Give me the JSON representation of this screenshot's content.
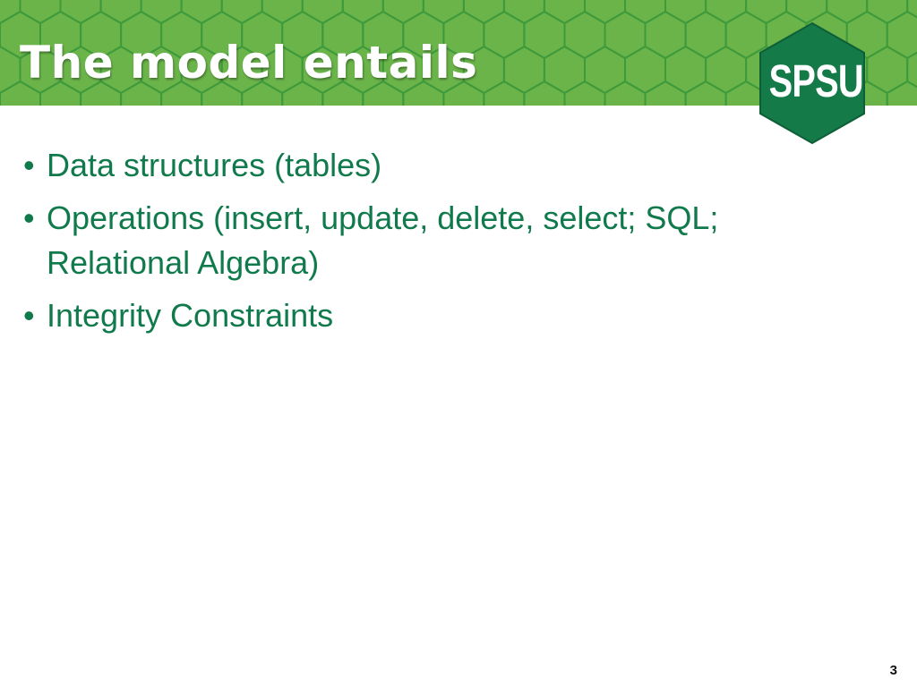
{
  "slide": {
    "title": "The model entails",
    "logo_text": "SPSU",
    "bullets": [
      {
        "text": "Data structures (tables)"
      },
      {
        "text": "Operations (insert, update, delete, select; SQL; Relational Algebra)"
      },
      {
        "text": "Integrity Constraints"
      }
    ],
    "bullet_marker": "•",
    "page_number": "3"
  },
  "colors": {
    "header_green": "#6ab44a",
    "hex_line": "#3f9a3c",
    "logo_green": "#147a48",
    "text_green": "#117a4c"
  }
}
